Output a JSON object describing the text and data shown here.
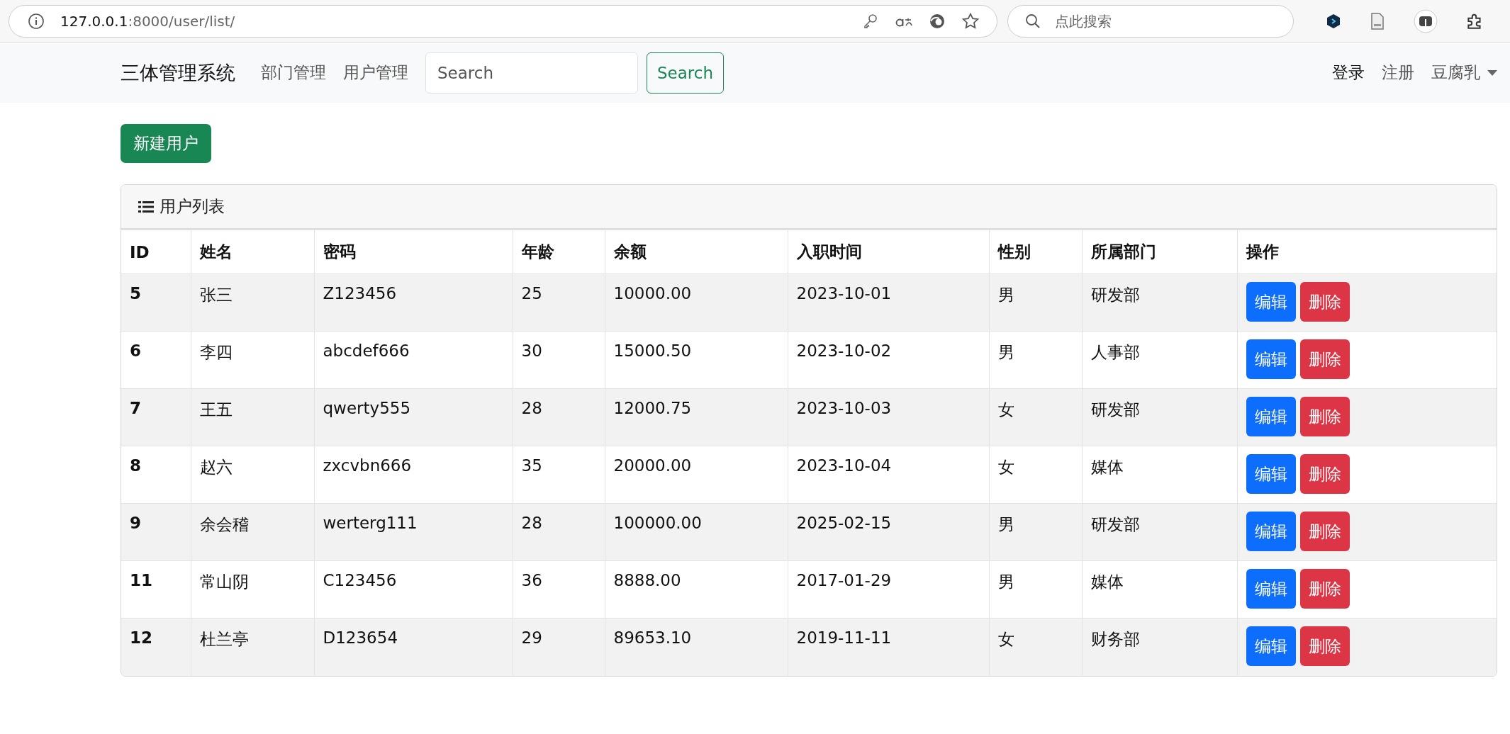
{
  "browser": {
    "url_host": "127.0.0.1",
    "url_rest": ":8000/user/list/",
    "search_placeholder": "点此搜索"
  },
  "navbar": {
    "brand": "三体管理系统",
    "links": [
      {
        "label": "部门管理",
        "selected": false
      },
      {
        "label": "用户管理",
        "selected": false
      }
    ],
    "search": {
      "placeholder": "Search",
      "button": "Search"
    },
    "right_links": [
      {
        "label": "登录",
        "selected": true
      },
      {
        "label": "注册",
        "selected": false
      }
    ],
    "user_menu": {
      "label": "豆腐乳"
    }
  },
  "new_button": "新建用户",
  "card": {
    "title": "用户列表"
  },
  "table": {
    "columns": [
      "ID",
      "姓名",
      "密码",
      "年龄",
      "余额",
      "入职时间",
      "性别",
      "所属部门",
      "操作"
    ],
    "rows": [
      {
        "cells": [
          "5",
          "张三",
          "Z123456",
          "25",
          "10000.00",
          "2023-10-01",
          "男",
          "研发部"
        ],
        "actions": [
          "编辑",
          "删除"
        ]
      },
      {
        "cells": [
          "6",
          "李四",
          "abcdef666",
          "30",
          "15000.50",
          "2023-10-02",
          "男",
          "人事部"
        ],
        "actions": [
          "编辑",
          "删除"
        ]
      },
      {
        "cells": [
          "7",
          "王五",
          "qwerty555",
          "28",
          "12000.75",
          "2023-10-03",
          "女",
          "研发部"
        ],
        "actions": [
          "编辑",
          "删除"
        ]
      },
      {
        "cells": [
          "8",
          "赵六",
          "zxcvbn666",
          "35",
          "20000.00",
          "2023-10-04",
          "女",
          "媒体"
        ],
        "actions": [
          "编辑",
          "删除"
        ]
      },
      {
        "cells": [
          "9",
          "余会稽",
          "werterg111",
          "28",
          "100000.00",
          "2025-02-15",
          "男",
          "研发部"
        ],
        "actions": [
          "编辑",
          "删除"
        ]
      },
      {
        "cells": [
          "11",
          "常山阴",
          "C123456",
          "36",
          "8888.00",
          "2017-01-29",
          "男",
          "媒体"
        ],
        "actions": [
          "编辑",
          "删除"
        ]
      },
      {
        "cells": [
          "12",
          "杜兰亭",
          "D123654",
          "29",
          "89653.10",
          "2019-11-11",
          "女",
          "财务部"
        ],
        "actions": [
          "编辑",
          "删除"
        ]
      }
    ]
  }
}
